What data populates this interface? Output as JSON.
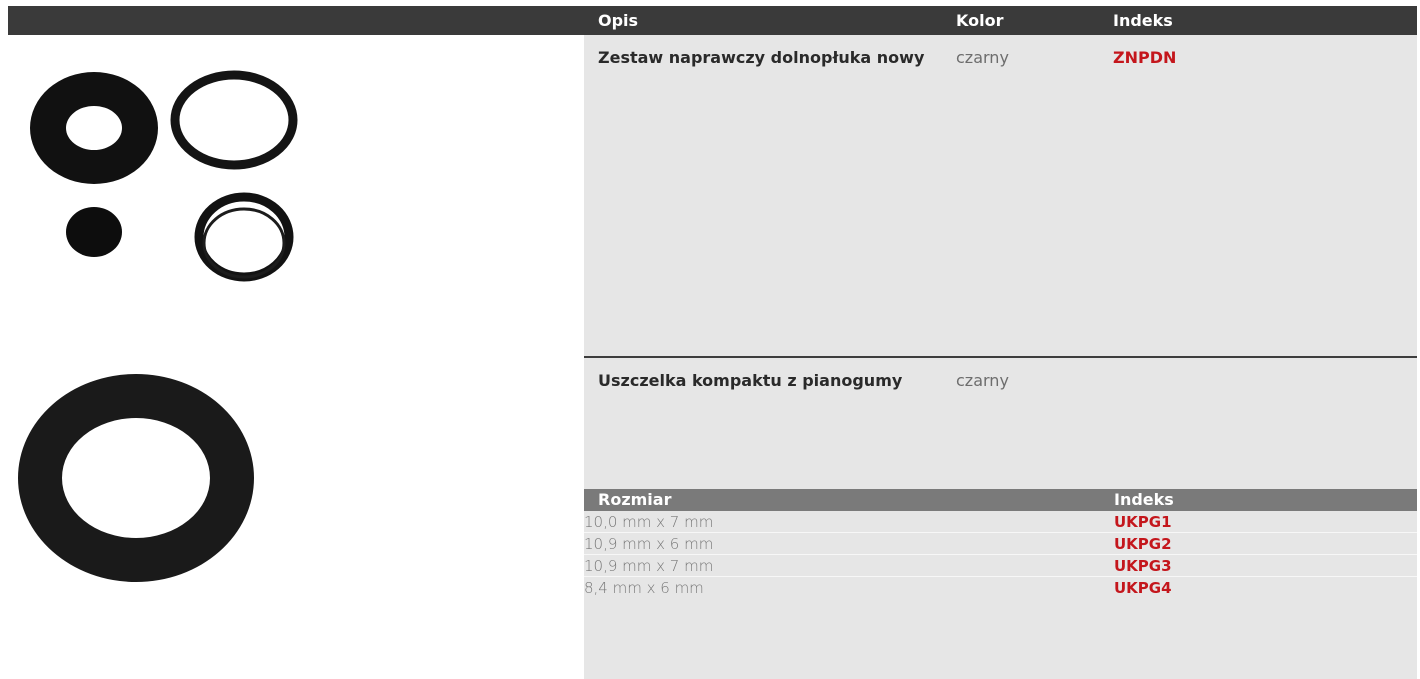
{
  "table_header": {
    "col_description": "Opis",
    "col_color": "Kolor",
    "col_index": "Indeks"
  },
  "products": [
    {
      "description": "Zestaw naprawczy dolnopłuka nowy",
      "color": "czarny",
      "index": "ZNPDN"
    },
    {
      "description": "Uszczelka kompaktu z pianogumy",
      "color": "czarny"
    }
  ],
  "sizes_header": {
    "col_size": "Rozmiar",
    "col_index": "Indeks"
  },
  "sizes": [
    {
      "size": "10,0 mm x 7 mm",
      "index": "UKPG1"
    },
    {
      "size": "10,9 mm x 6 mm",
      "index": "UKPG2"
    },
    {
      "size": "10,9 mm x 7 mm",
      "index": "UKPG3"
    },
    {
      "size": "8,4 mm x 6 mm",
      "index": "UKPG4"
    }
  ],
  "colors": {
    "header_bg": "#3a3a3a",
    "panel_bg": "#e6e6e6",
    "accent_red": "#c4161c",
    "subheader_bg": "#7a7a7a"
  }
}
